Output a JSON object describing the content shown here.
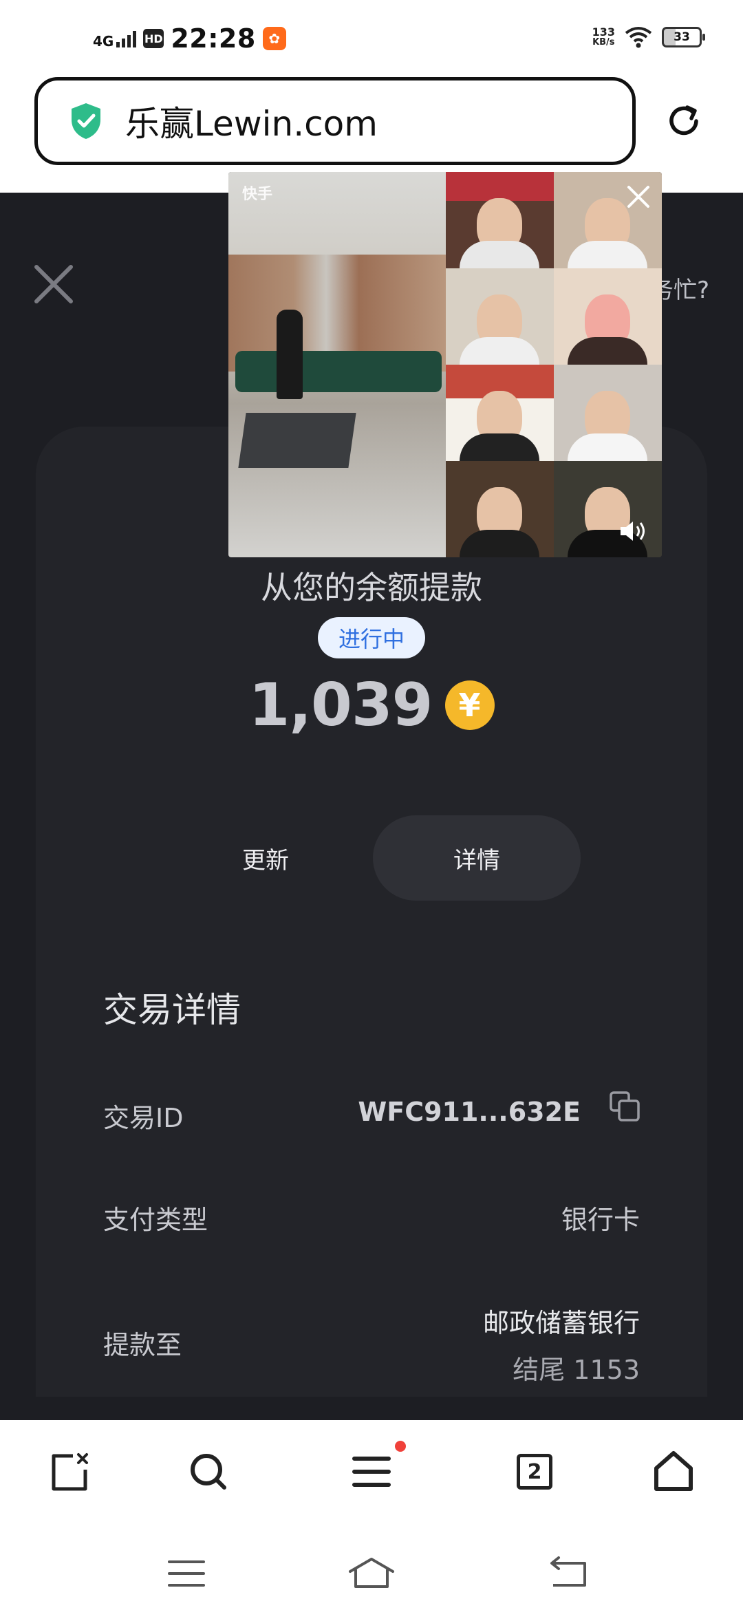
{
  "status_bar": {
    "network": "4G",
    "hd": "HD",
    "time": "22:28",
    "speed_value": "133",
    "speed_unit": "KB/s",
    "battery": "33"
  },
  "browser": {
    "url": "乐赢Lewin.com",
    "tab_count": "2"
  },
  "page": {
    "help_text": "务忙?",
    "withdraw_title": "从您的余额提款",
    "status": "进行中",
    "amount": "1,039",
    "currency_symbol": "¥",
    "refresh_label": "更新",
    "details_label": "详情",
    "section_title": "交易详情",
    "rows": [
      {
        "label": "交易ID",
        "value": "WFC911...632E"
      },
      {
        "label": "支付类型",
        "value": "银行卡"
      },
      {
        "label": "提款至",
        "value": "邮政储蓄银行",
        "sub": "结尾 1153"
      }
    ]
  },
  "video_overlay": {
    "app_label": "快手"
  },
  "colors": {
    "page_bg": "#1d1e23",
    "card_bg": "#232429",
    "status_pill_bg": "#eaf2ff",
    "status_pill_text": "#2f6fe0",
    "coin": "#f5b82a",
    "shield": "#2ebc8a"
  },
  "icons": {
    "shield": "shield-check-icon",
    "reload": "reload-icon",
    "close": "close-icon",
    "copy": "copy-icon",
    "toolbar": [
      "close-tab-icon",
      "search-icon",
      "menu-icon",
      "tabs-icon",
      "home-icon"
    ],
    "sysnav": [
      "recents-icon",
      "home-nav-icon",
      "back-icon"
    ]
  }
}
